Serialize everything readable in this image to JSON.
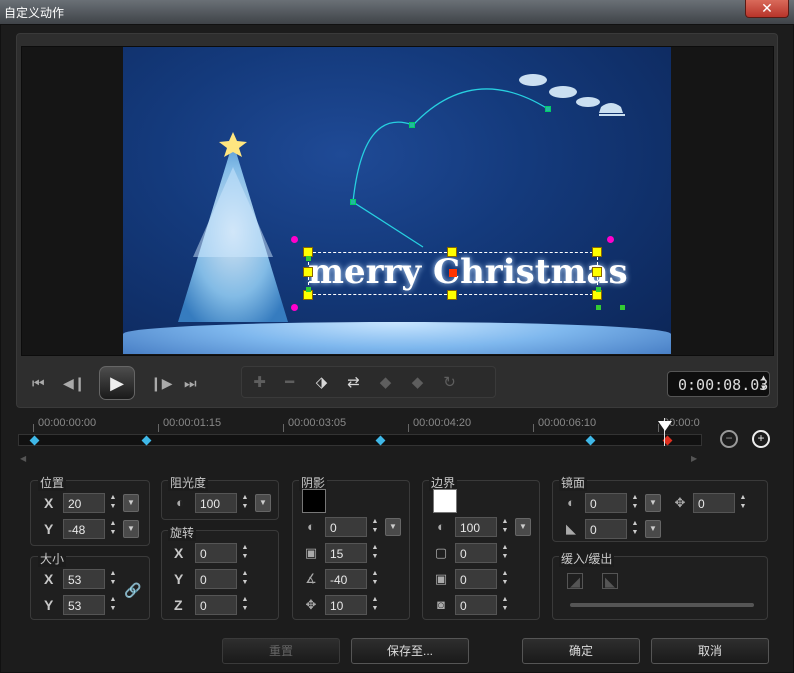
{
  "window": {
    "title": "自定义动作",
    "close": "✕"
  },
  "preview": {
    "text": "merry Christmas"
  },
  "transport": {
    "timecode": "0:00:08.03"
  },
  "timeline": {
    "labels": [
      "00:00:00:00",
      "00:00:01:15",
      "00:00:03:05",
      "00:00:04:20",
      "00:00:06:10",
      "00:00:0"
    ]
  },
  "position": {
    "label": "位置",
    "x_label": "X",
    "x": "20",
    "y_label": "Y",
    "y": "-48"
  },
  "size": {
    "label": "大小",
    "x_label": "X",
    "x": "53",
    "y_label": "Y",
    "y": "53"
  },
  "opacity": {
    "label": "阻光度",
    "value": "100"
  },
  "rotation": {
    "label": "旋转",
    "x_label": "X",
    "x": "0",
    "y_label": "Y",
    "y": "0",
    "z_label": "Z",
    "z": "0"
  },
  "shadow": {
    "label": "阴影",
    "color": "#000000",
    "opacity": "0",
    "blur": "15",
    "angle": "-40",
    "distance": "10"
  },
  "border": {
    "label": "边界",
    "color": "#ffffff",
    "opacity": "100",
    "width": "0",
    "blur": "0",
    "corner": "0"
  },
  "mirror": {
    "label": "镜面",
    "opacity": "0",
    "distance": "0",
    "fade": "0"
  },
  "fade": {
    "label": "缓入/缓出"
  },
  "buttons": {
    "reset": "重置",
    "save": "保存至...",
    "ok": "确定",
    "cancel": "取消"
  }
}
